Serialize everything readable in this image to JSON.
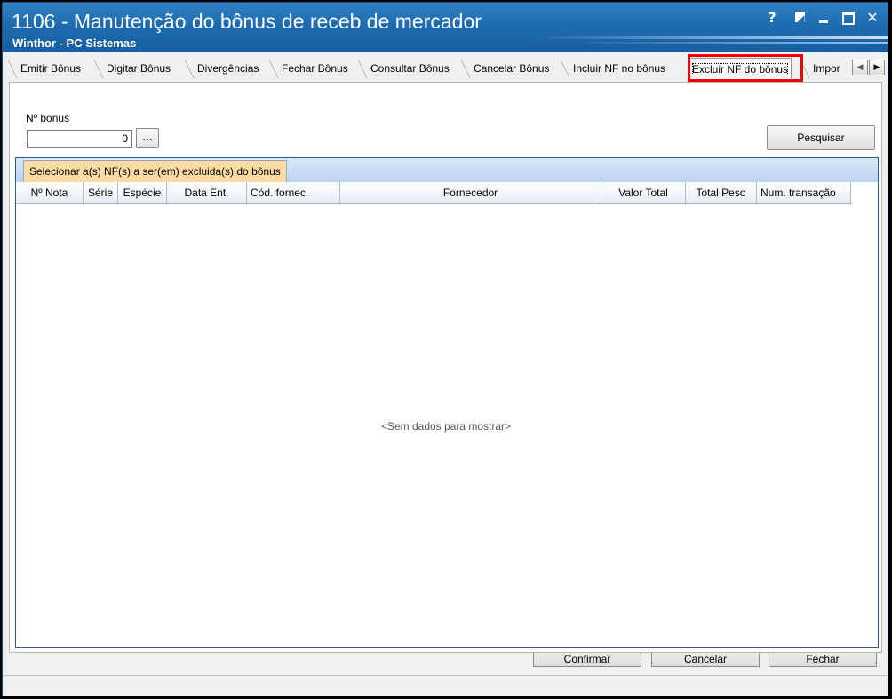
{
  "window": {
    "title": "1106 - Manutenção do bônus de receb de mercador",
    "subtitle": "Winthor - PC Sistemas",
    "controls": {
      "help": "?",
      "minimize": "_",
      "close": "✕"
    }
  },
  "tabs": [
    {
      "label": "Emitir Bônus"
    },
    {
      "label": "Digitar Bônus"
    },
    {
      "label": "Divergências"
    },
    {
      "label": "Fechar Bônus"
    },
    {
      "label": "Consultar Bônus"
    },
    {
      "label": "Cancelar Bônus"
    },
    {
      "label": "Incluir NF no bônus"
    },
    {
      "label": "Excluir NF do bônus",
      "active": true
    },
    {
      "label": "Impor"
    }
  ],
  "tab_scroll": {
    "left": "◀",
    "right": "▶"
  },
  "search": {
    "bonus_label": "Nº bonus",
    "bonus_value": "0",
    "ellipsis_label": "...",
    "search_button": "Pesquisar"
  },
  "grid": {
    "caption": "Selecionar a(s) NF(s) a ser(em) excluida(s) do bônus",
    "columns": [
      "Nº Nota",
      "Série",
      "Espécie",
      "Data Ent.",
      "Cód. fornec.",
      "Fornecedor",
      "Valor Total",
      "Total Peso",
      "Num. transação"
    ],
    "empty_text": "<Sem dados para mostrar>"
  },
  "footer": {
    "confirm": "Confirmar",
    "cancel": "Cancelar",
    "close": "Fechar"
  }
}
